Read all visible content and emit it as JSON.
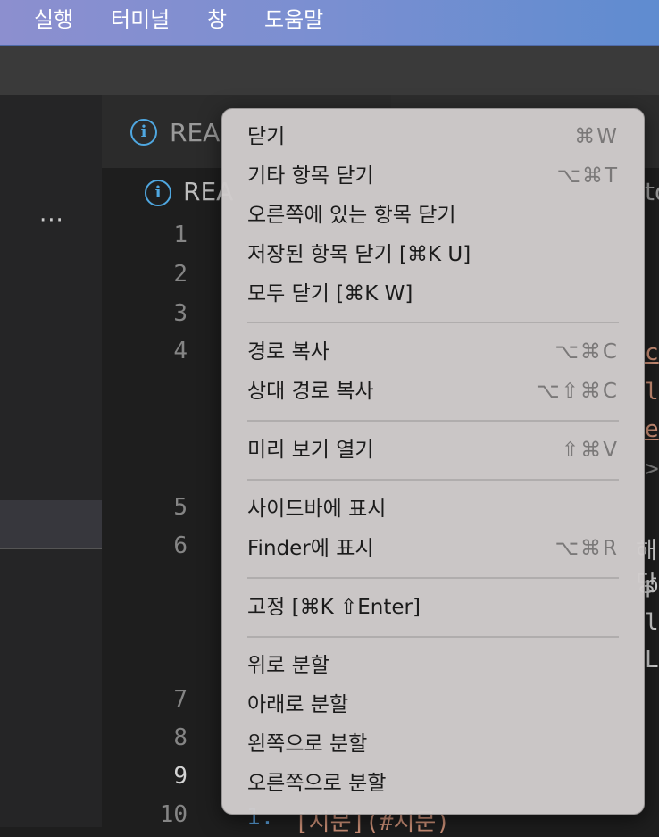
{
  "menubar": {
    "items": [
      "실행",
      "터미널",
      "창",
      "도움말"
    ]
  },
  "sidebar": {
    "more_label": "···"
  },
  "tab": {
    "label": "REA"
  },
  "breadcrumb": {
    "label": "REA",
    "right_fragment": "to"
  },
  "editor": {
    "line_numbers": [
      "1",
      "2",
      "3",
      "4",
      "5",
      "6",
      "7",
      "8",
      "9",
      "10"
    ],
    "code_fragments": [
      "c",
      "li",
      "e",
      ">",
      "해당",
      "p",
      "l",
      "L",
      "1.",
      "[지문](#지문)"
    ]
  },
  "context_menu": {
    "groups": [
      [
        {
          "label": "닫기",
          "shortcut": "⌘W"
        },
        {
          "label": "기타 항목 닫기",
          "shortcut": "⌥⌘T"
        },
        {
          "label": "오른쪽에 있는 항목 닫기",
          "shortcut": ""
        },
        {
          "label": "저장된 항목 닫기 [⌘K U]",
          "shortcut": ""
        },
        {
          "label": "모두 닫기 [⌘K W]",
          "shortcut": ""
        }
      ],
      [
        {
          "label": "경로 복사",
          "shortcut": "⌥⌘C"
        },
        {
          "label": "상대 경로 복사",
          "shortcut": "⌥⇧⌘C"
        }
      ],
      [
        {
          "label": "미리 보기 열기",
          "shortcut": "⇧⌘V"
        }
      ],
      [
        {
          "label": "사이드바에 표시",
          "shortcut": ""
        },
        {
          "label": "Finder에 표시",
          "shortcut": "⌥⌘R"
        }
      ],
      [
        {
          "label": "고정 [⌘K ⇧Enter]",
          "shortcut": ""
        }
      ],
      [
        {
          "label": "위로 분할",
          "shortcut": ""
        },
        {
          "label": "아래로 분할",
          "shortcut": ""
        },
        {
          "label": "왼쪽으로 분할",
          "shortcut": ""
        },
        {
          "label": "오른쪽으로 분할",
          "shortcut": ""
        }
      ]
    ]
  }
}
